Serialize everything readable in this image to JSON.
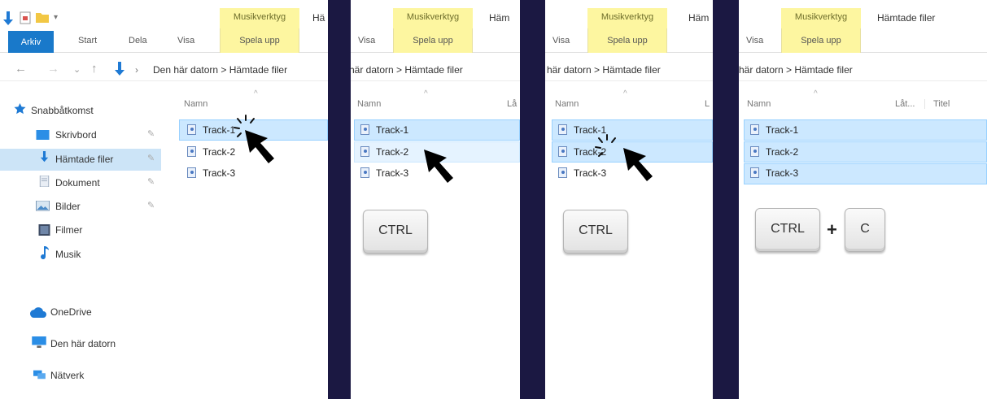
{
  "ribbon": {
    "tab_file": "Arkiv",
    "tab_start": "Start",
    "tab_share": "Dela",
    "tab_view": "Visa",
    "context_group": "Musikverktyg",
    "context_tab": "Spela upp",
    "window_title": "Hämtade filer",
    "window_title_cut": "Hä",
    "window_title_cut2": "Häm",
    "window_title_cut3": "Häm"
  },
  "address": {
    "path_full": "Den här datorn  >  Hämtade filer",
    "path_cropped": "här datorn  >  Hämtade filer"
  },
  "navpane": {
    "quick_access": "Snabbåtkomst",
    "items": [
      {
        "label": "Skrivbord",
        "icon": "desktop-icon",
        "pinned": true
      },
      {
        "label": "Hämtade filer",
        "icon": "download-icon",
        "pinned": true
      },
      {
        "label": "Dokument",
        "icon": "document-icon",
        "pinned": true
      },
      {
        "label": "Bilder",
        "icon": "pictures-icon",
        "pinned": true
      },
      {
        "label": "Filmer",
        "icon": "videos-icon",
        "pinned": false
      },
      {
        "label": "Musik",
        "icon": "music-icon",
        "pinned": false
      }
    ],
    "onedrive": "OneDrive",
    "this_pc": "Den här datorn",
    "network": "Nätverk"
  },
  "columns": {
    "name": "Namn",
    "track_cut": "Lå",
    "track_cut2": "L",
    "track": "Låt...",
    "title": "Titel"
  },
  "files": [
    "Track-1",
    "Track-2",
    "Track-3"
  ],
  "keys": {
    "ctrl": "CTRL",
    "plus": "+",
    "c": "C"
  },
  "colors": {
    "selection": "#cce8ff",
    "context_tab": "#fdf6a0",
    "file_tab": "#1979ca",
    "divider": "#1b1842"
  }
}
